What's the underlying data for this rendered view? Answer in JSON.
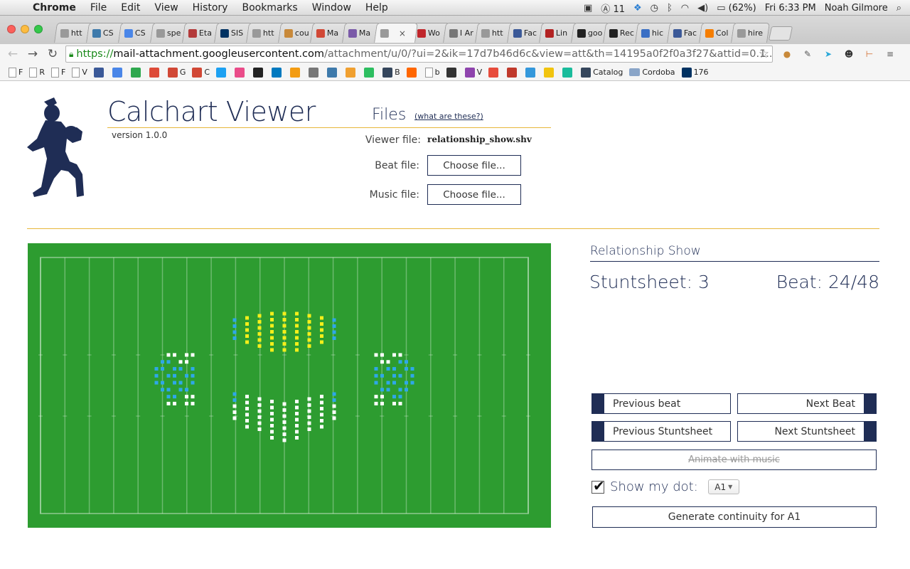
{
  "menubar": {
    "app": "Chrome",
    "items": [
      "File",
      "Edit",
      "View",
      "History",
      "Bookmarks",
      "Window",
      "Help"
    ],
    "status": {
      "notifications_count": "11",
      "battery": "(62%)",
      "clock": "Fri 6:33 PM",
      "user": "Noah Gilmore"
    }
  },
  "tabs": [
    {
      "label": "htt",
      "icon": "page-icon",
      "color": "#999999"
    },
    {
      "label": "CS",
      "icon": "piazza-icon",
      "color": "#3e7aab"
    },
    {
      "label": "CS",
      "icon": "docs-icon",
      "color": "#4a86e8"
    },
    {
      "label": "spe",
      "icon": "page-icon",
      "color": "#999999"
    },
    {
      "label": "Eta",
      "icon": "shield-icon",
      "color": "#b33a3a"
    },
    {
      "label": "SIS",
      "icon": "cal-icon",
      "color": "#003262"
    },
    {
      "label": "htt",
      "icon": "page-icon",
      "color": "#999999"
    },
    {
      "label": "cou",
      "icon": "course-icon",
      "color": "#c8893a"
    },
    {
      "label": "Ma",
      "icon": "gmail-icon",
      "color": "#d14836"
    },
    {
      "label": "Ma",
      "icon": "paw-icon",
      "color": "#7a5aa8"
    },
    {
      "label": "",
      "icon": "page-icon",
      "color": "#999999",
      "active": true
    },
    {
      "label": "Wo",
      "icon": "wolfram-icon",
      "color": "#c0262b"
    },
    {
      "label": "I Ar",
      "icon": "robot-icon",
      "color": "#777777"
    },
    {
      "label": "htt",
      "icon": "page-icon",
      "color": "#999999"
    },
    {
      "label": "Fac",
      "icon": "facebook-icon",
      "color": "#3b5998"
    },
    {
      "label": "Lin",
      "icon": "vb-icon",
      "color": "#b22222"
    },
    {
      "label": "goo",
      "icon": "github-icon",
      "color": "#222222"
    },
    {
      "label": "Rec",
      "icon": "github-icon",
      "color": "#222222"
    },
    {
      "label": "hic",
      "icon": "moon-icon",
      "color": "#3a6fc4"
    },
    {
      "label": "Fac",
      "icon": "facebook-icon",
      "color": "#3b5998"
    },
    {
      "label": "Col",
      "icon": "blogger-icon",
      "color": "#f57d00"
    },
    {
      "label": "hire",
      "icon": "page-icon",
      "color": "#999999"
    }
  ],
  "toolbar": {
    "url_scheme": "https://",
    "url_host": "mail-attachment.googleusercontent.com",
    "url_path": "/attachment/u/0/?ui=2&ik=17d7b46d6c&view=att&th=14195a0f2f0a3f27&attid=0.1..."
  },
  "bookmarks": [
    {
      "label": "F",
      "icon": "page-icon",
      "color": "#ffffff"
    },
    {
      "label": "R",
      "icon": "page-icon",
      "color": "#ffffff"
    },
    {
      "label": "F",
      "icon": "page-icon",
      "color": "#ffffff"
    },
    {
      "label": "V",
      "icon": "page-icon",
      "color": "#ffffff"
    },
    {
      "label": "",
      "icon": "facebook-icon",
      "color": "#3b5998"
    },
    {
      "label": "",
      "icon": "calendar-icon",
      "color": "#4a86e8"
    },
    {
      "label": "",
      "icon": "drive-icon",
      "color": "#2fa84f"
    },
    {
      "label": "",
      "icon": "gplus-icon",
      "color": "#dd4b39"
    },
    {
      "label": "G",
      "icon": "gmail-icon",
      "color": "#d14836"
    },
    {
      "label": "C",
      "icon": "gmail-icon",
      "color": "#d14836"
    },
    {
      "label": "",
      "icon": "twitter-icon",
      "color": "#1da1f2"
    },
    {
      "label": "",
      "icon": "dribbble-icon",
      "color": "#ea4c89"
    },
    {
      "label": "",
      "icon": "github-icon",
      "color": "#222222"
    },
    {
      "label": "",
      "icon": "trello-icon",
      "color": "#0079bf"
    },
    {
      "label": "",
      "icon": "u-icon",
      "color": "#f39c12"
    },
    {
      "label": "",
      "icon": "robot-icon",
      "color": "#777777"
    },
    {
      "label": "",
      "icon": "piazza-icon",
      "color": "#3e7aab"
    },
    {
      "label": "",
      "icon": "chart-icon",
      "color": "#f0a030"
    },
    {
      "label": "",
      "icon": "evernote-icon",
      "color": "#2dbe60"
    },
    {
      "label": "B",
      "icon": "tumblr-icon",
      "color": "#35465c"
    },
    {
      "label": "",
      "icon": "ycombinator-icon",
      "color": "#ff6600"
    },
    {
      "label": "b",
      "icon": "page-icon",
      "color": "#ffffff"
    },
    {
      "label": "",
      "icon": "grid-icon",
      "color": "#333333"
    },
    {
      "label": "V",
      "icon": "box-icon",
      "color": "#8e44ad"
    },
    {
      "label": "",
      "icon": "swift-icon",
      "color": "#e74c3c"
    },
    {
      "label": "",
      "icon": "24-icon",
      "color": "#c0392b"
    },
    {
      "label": "",
      "icon": "chat-icon",
      "color": "#3498db"
    },
    {
      "label": "",
      "icon": "cube-icon",
      "color": "#f1c40f"
    },
    {
      "label": "",
      "icon": "drop-icon",
      "color": "#1abc9c"
    },
    {
      "label": "Catalog",
      "icon": "tumblr-icon",
      "color": "#35465c"
    },
    {
      "label": "Cordoba",
      "icon": "folder-icon",
      "color": "#8aa5c8"
    },
    {
      "label": "176",
      "icon": "eecs-icon",
      "color": "#003262"
    }
  ],
  "app": {
    "title": "Calchart Viewer",
    "version": "version 1.0.0",
    "files_heading": "Files",
    "files_help": "(what are these?)",
    "viewer_file_label": "Viewer file:",
    "viewer_file_value": "relationship_show.shv",
    "beat_file_label": "Beat file:",
    "music_file_label": "Music file:",
    "choose_file": "Choose file...",
    "show_name": "Relationship Show",
    "stuntsheet": "Stuntsheet: 3",
    "beat": "Beat: 24/48",
    "prev_beat": "Previous beat",
    "next_beat": "Next Beat",
    "prev_stuntsheet": "Previous Stuntsheet",
    "next_stuntsheet": "Next Stuntsheet",
    "animate": "Animate with music",
    "show_my_dot": "Show my dot:",
    "show_my_dot_checked": true,
    "dot_selected": "A1",
    "generate": "Generate continuity for A1",
    "colors": {
      "navy": "#1f2d55",
      "gold": "#e7b73a",
      "field": "#2d9c30",
      "dot_white": "#ffffff",
      "dot_yellow": "#f5ef1a",
      "dot_blue": "#2ea8e8"
    }
  }
}
